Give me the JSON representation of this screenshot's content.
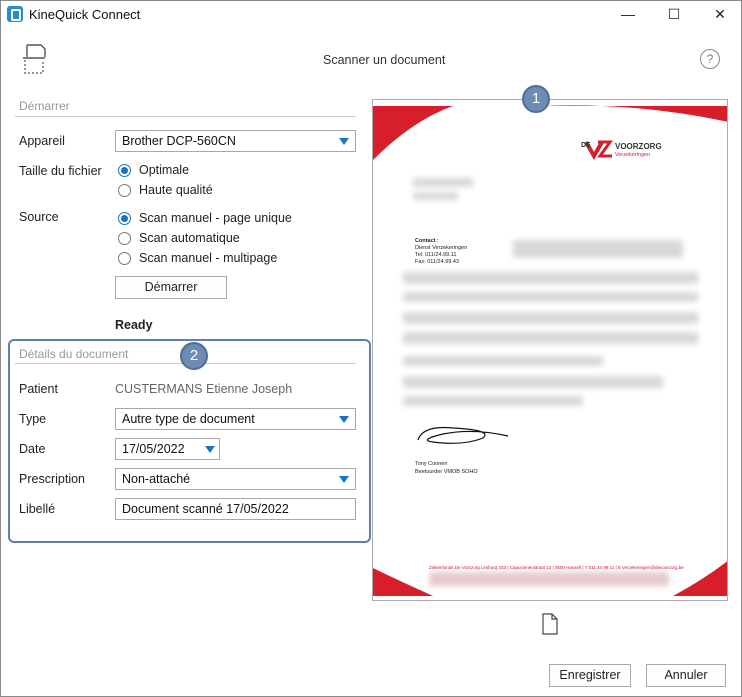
{
  "window": {
    "title": "KineQuick Connect",
    "minimize": "—",
    "maximize": "☐",
    "close": "✕"
  },
  "header": {
    "title": "Scanner un document",
    "help": "?"
  },
  "start_section": {
    "title": "Démarrer",
    "device_label": "Appareil",
    "device_value": "Brother DCP-560CN",
    "filesize_label": "Taille du fichier",
    "filesize_options": [
      "Optimale",
      "Haute qualité"
    ],
    "filesize_selected": "Optimale",
    "source_label": "Source",
    "source_options": [
      "Scan manuel - page unique",
      "Scan automatique",
      "Scan manuel - multipage"
    ],
    "source_selected": "Scan manuel - page unique",
    "start_button": "Démarrer",
    "status": "Ready"
  },
  "details_section": {
    "title": "Détails du document",
    "patient_label": "Patient",
    "patient_value": "CUSTERMANS Etienne Joseph",
    "type_label": "Type",
    "type_value": "Autre type de document",
    "date_label": "Date",
    "date_value": "17/05/2022",
    "prescription_label": "Prescription",
    "prescription_value": "Non-attaché",
    "libelle_label": "Libellé",
    "libelle_value": "Document scanné 17/05/2022"
  },
  "badges": {
    "preview": "1",
    "details": "2"
  },
  "preview_doc": {
    "logo_text": "VOORZORG",
    "logo_prefix": "DE",
    "logo_sub": "Verzekeringen",
    "contact_title": "Contact :",
    "contact_lines": [
      "Dienst Verzekeringen",
      "Tel: 011/24.99.11",
      "Fax: 011/24.99.43"
    ],
    "signer_name": "Tony Coonen",
    "signer_role": "Beetuurder VMOB SOHO",
    "footer": "Ziekenfonds De Voorzorg Limburg 333 | Capucienenstraat 12 | 3500 Hasselt | T 011 24 99 11 | E verzekeringen@devoorzorg.be"
  },
  "footer": {
    "save_button": "Enregistrer",
    "cancel_button": "Annuler"
  },
  "colors": {
    "accent": "#1a73c7",
    "badge": "#6d8bb3",
    "red": "#d71f2b"
  }
}
